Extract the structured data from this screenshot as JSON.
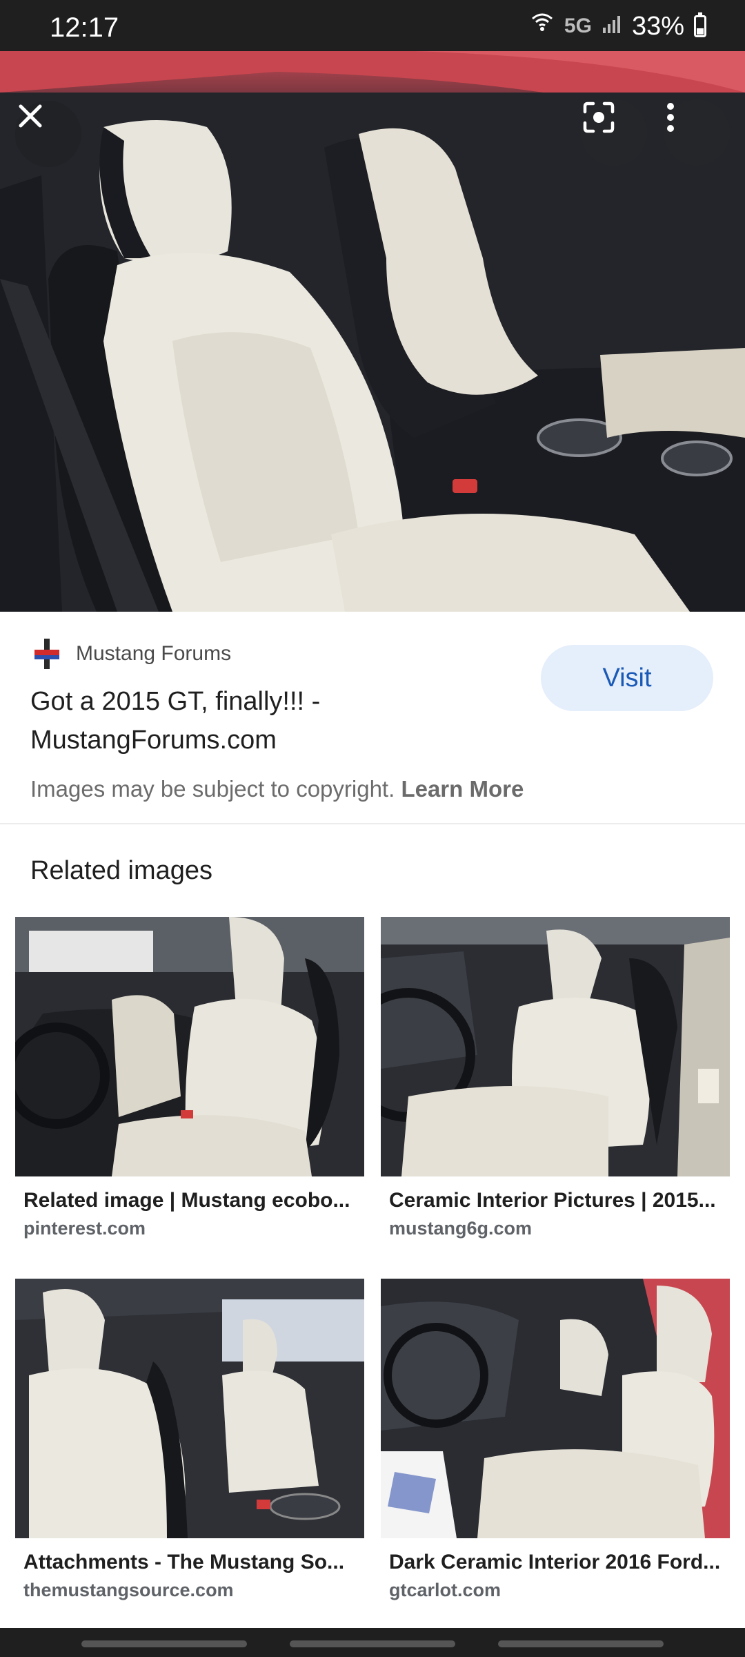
{
  "status_bar": {
    "time": "12:17",
    "network": "5G",
    "battery": "33%",
    "battery_level": 0.33
  },
  "hero": {
    "close_icon": "close-icon",
    "lens_icon": "lens-icon",
    "more_icon": "more-vert-icon"
  },
  "source": {
    "site_name": "Mustang Forums",
    "title": "Got a 2015 GT, finally!!! - MustangForums.com",
    "visit_label": "Visit",
    "copyright_text": "Images may be subject to copyright.",
    "learn_more_label": "Learn More"
  },
  "related": {
    "heading": "Related images",
    "items": [
      {
        "title": "Related image | Mustang ecobo...",
        "domain": "pinterest.com"
      },
      {
        "title": "Ceramic Interior Pictures | 2015...",
        "domain": "mustang6g.com"
      },
      {
        "title": "Attachments - The Mustang So...",
        "domain": "themustangsource.com"
      },
      {
        "title": "Dark Ceramic Interior 2016 Ford...",
        "domain": "gtcarlot.com"
      }
    ]
  },
  "colors": {
    "accent": "#1a5ab6",
    "visit_bg": "#e5eefb"
  }
}
